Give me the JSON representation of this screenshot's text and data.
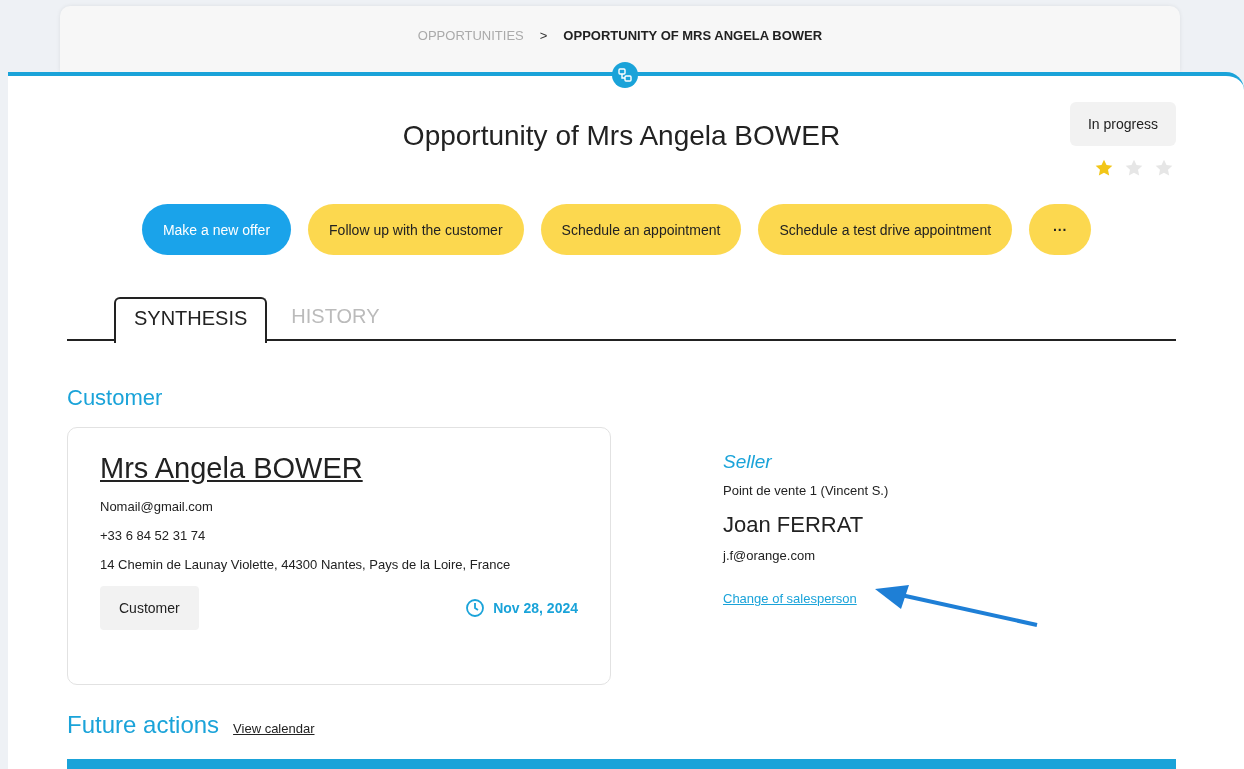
{
  "breadcrumb": [
    {
      "label": "OPPORTUNITIES",
      "current": false
    },
    {
      "label": "OPPORTUNITY OF MRS ANGELA BOWER",
      "current": true
    }
  ],
  "breadcrumb_separator": ">",
  "title": "Opportunity of Mrs Angela BOWER",
  "status": {
    "label": "In progress",
    "stars": 1
  },
  "actions": [
    {
      "label": "Make a new offer",
      "kind": "primary"
    },
    {
      "label": "Follow up with the customer",
      "kind": "secondary"
    },
    {
      "label": "Schedule an appointment",
      "kind": "secondary"
    },
    {
      "label": "Schedule a test drive appointment",
      "kind": "secondary"
    },
    {
      "label": "···",
      "kind": "more"
    }
  ],
  "tabs": [
    {
      "label": "SYNTHESIS",
      "selected": true
    },
    {
      "label": "HISTORY",
      "selected": false
    }
  ],
  "customer_section": {
    "heading": "Customer",
    "card": {
      "name": "Mrs Angela BOWER",
      "email": "Nomail@gmail.com",
      "phone": "+33 6 84 52 31 74",
      "address": "14 Chemin de Launay Violette, 44300 Nantes, Pays de la Loire, France",
      "tag": "Customer",
      "date": "Nov 28, 2024"
    },
    "seller": {
      "heading": "Seller",
      "point_of_sale": "Point de vente 1 (Vincent S.)",
      "name": "Joan FERRAT",
      "email": "j.f@orange.com",
      "link": "Change of salesperson"
    }
  },
  "future_actions": {
    "heading": "Future actions",
    "link": "View calendar"
  }
}
